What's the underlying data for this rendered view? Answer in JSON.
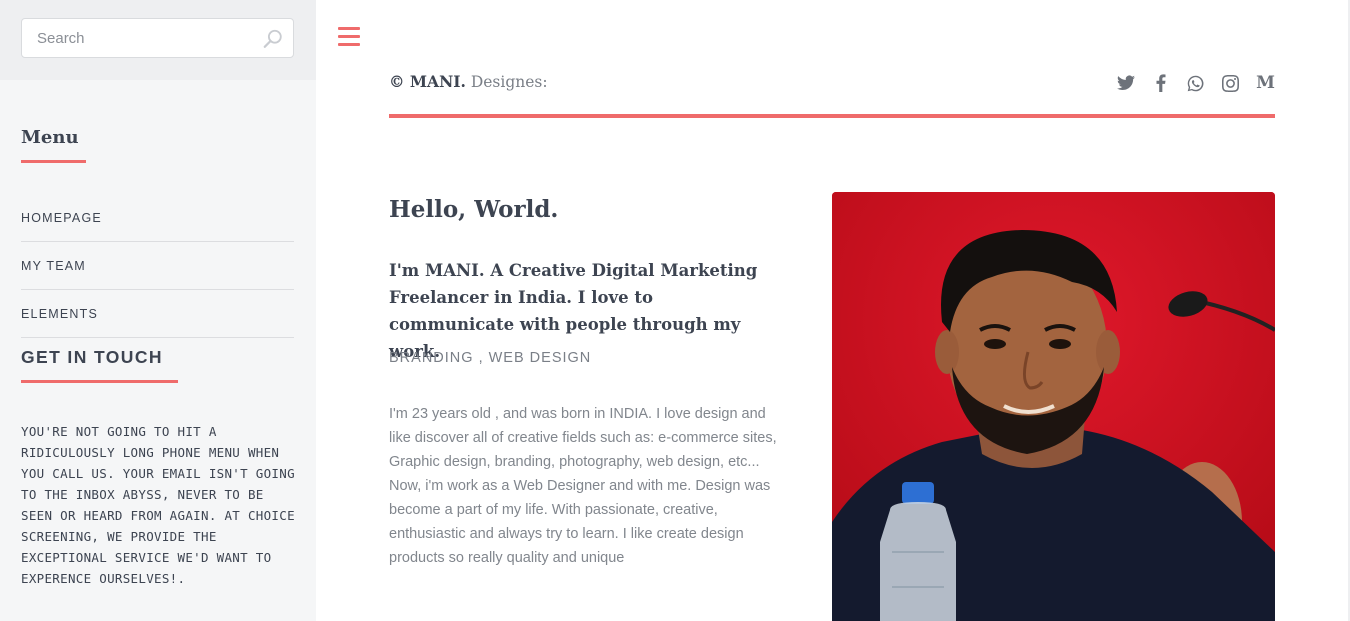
{
  "search": {
    "placeholder": "Search"
  },
  "sidebar": {
    "menu_title": "Menu",
    "items": [
      {
        "label": "HOMEPAGE"
      },
      {
        "label": "MY TEAM"
      },
      {
        "label": "ELEMENTS"
      }
    ],
    "get_in_touch_title": "GET IN TOUCH",
    "get_in_touch_text": "YOU'RE NOT GOING TO HIT A RIDICULOUSLY LONG PHONE MENU WHEN YOU CALL US. YOUR EMAIL ISN'T GOING TO THE INBOX ABYSS, NEVER TO BE SEEN OR HEARD FROM AGAIN. AT CHOICE SCREENING, WE PROVIDE THE EXCEPTIONAL SERVICE WE'D WANT TO EXPERENCE OURSELVES!."
  },
  "header": {
    "brand_copyright": "© MANI.",
    "brand_suffix": " Designes:",
    "social_icons": [
      "twitter-icon",
      "facebook-icon",
      "whatsapp-icon",
      "instagram-icon",
      "medium-icon"
    ],
    "medium_letter": "M"
  },
  "main": {
    "greeting": "Hello, World.",
    "intro": "I'm MANI. A Creative Digital Marketing Freelancer in India. I love to communicate with people through my work.",
    "tags": "BRANDING , WEB DESIGN",
    "bio": "I'm 23 years old , and was born in INDIA. I love design and like discover all of creative fields such as: e-commerce sites, Graphic design, branding, photography, web design, etc... Now, i'm work as a Web Designer and with me. Design was become a part of my life. With passionate, creative, enthusiastic and always try to learn. I like create design products so really quality and unique"
  },
  "colors": {
    "accent": "#ef6b6b",
    "sidebar_bg": "#f5f6f7",
    "photo_bg": "#c8101e"
  }
}
